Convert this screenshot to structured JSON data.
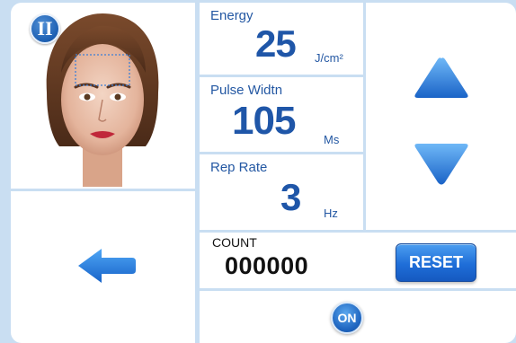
{
  "mode": {
    "badge": "II"
  },
  "energy": {
    "label": "Energy",
    "value": "25",
    "unit": "J/cm²"
  },
  "pulse": {
    "label": "Pulse Widtn",
    "value": "105",
    "unit": "Ms"
  },
  "rep": {
    "label": "Rep Rate",
    "value": "3",
    "unit": "Hz"
  },
  "count": {
    "label": "COUNT",
    "value": "000000"
  },
  "buttons": {
    "reset": "RESET",
    "on": "ON"
  },
  "icons": {
    "back": "left-arrow-icon",
    "up": "up-triangle-icon",
    "down": "down-triangle-icon",
    "portrait": "face-portrait-icon"
  },
  "colors": {
    "accent": "#1f56a8",
    "background": "#c9def2",
    "button": "#1f6ed8"
  }
}
